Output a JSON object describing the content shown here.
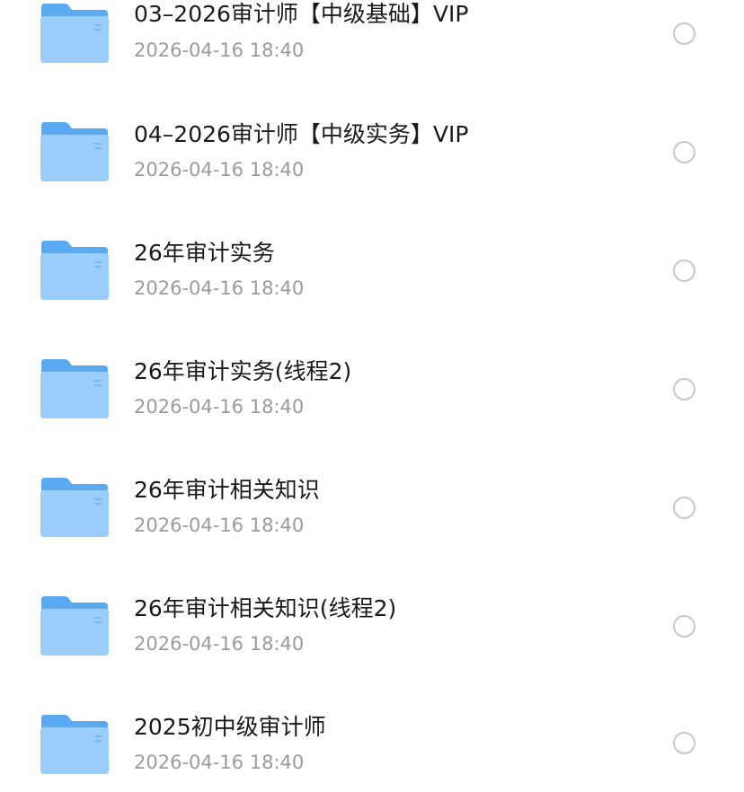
{
  "files": [
    {
      "name": "03–2026审计师【中级基础】VIP",
      "date": "2026-04-16 18:40",
      "icon": "folder-icon"
    },
    {
      "name": "04–2026审计师【中级实务】VIP",
      "date": "2026-04-16 18:40",
      "icon": "folder-icon"
    },
    {
      "name": "26年审计实务",
      "date": "2026-04-16 18:40",
      "icon": "folder-icon"
    },
    {
      "name": "26年审计实务(线程2)",
      "date": "2026-04-16 18:40",
      "icon": "folder-icon"
    },
    {
      "name": "26年审计相关知识",
      "date": "2026-04-16 18:40",
      "icon": "folder-icon"
    },
    {
      "name": "26年审计相关知识(线程2)",
      "date": "2026-04-16 18:40",
      "icon": "folder-icon"
    },
    {
      "name": "2025初中级审计师",
      "date": "2026-04-16 18:40",
      "icon": "folder-icon"
    }
  ],
  "colors": {
    "folder_back": "#5aaaf2",
    "folder_front": "#8fc8f8",
    "name_text": "#1a1a1a",
    "date_text": "#9b9b9b",
    "radio_border": "#c8c8c8"
  }
}
